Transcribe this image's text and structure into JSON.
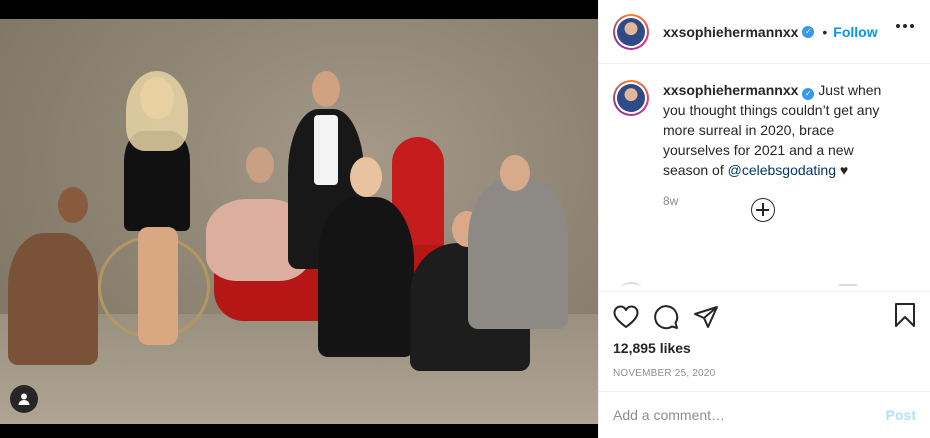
{
  "post": {
    "image_alt": "Cast photo of Celebs Go Dating on a red sofa",
    "header": {
      "username": "xxsophiehermannxx",
      "separator": "•",
      "follow_label": "Follow"
    },
    "caption": {
      "username": "xxsophiehermannxx",
      "text": "Just when you thought things couldn’t get any more surreal in 2020, brace yourselves for 2021 and a new season of",
      "mention": "@celebsgodating",
      "suffix": "♥",
      "age": "8w"
    },
    "likes": "12,895 likes",
    "date": "NOVEMBER 25, 2020",
    "comment_box": {
      "placeholder": "Add a comment…",
      "post_label": "Post"
    }
  },
  "colors": {
    "accent": "#0095f6",
    "verified": "#3897f0",
    "sofa": "#c51d1d",
    "post_disabled": "#b2dffc"
  },
  "icons": [
    "user-tag-icon",
    "verified-icon",
    "more-options-icon",
    "load-more-comments-icon",
    "heart-icon",
    "comment-icon",
    "share-icon",
    "bookmark-icon"
  ]
}
